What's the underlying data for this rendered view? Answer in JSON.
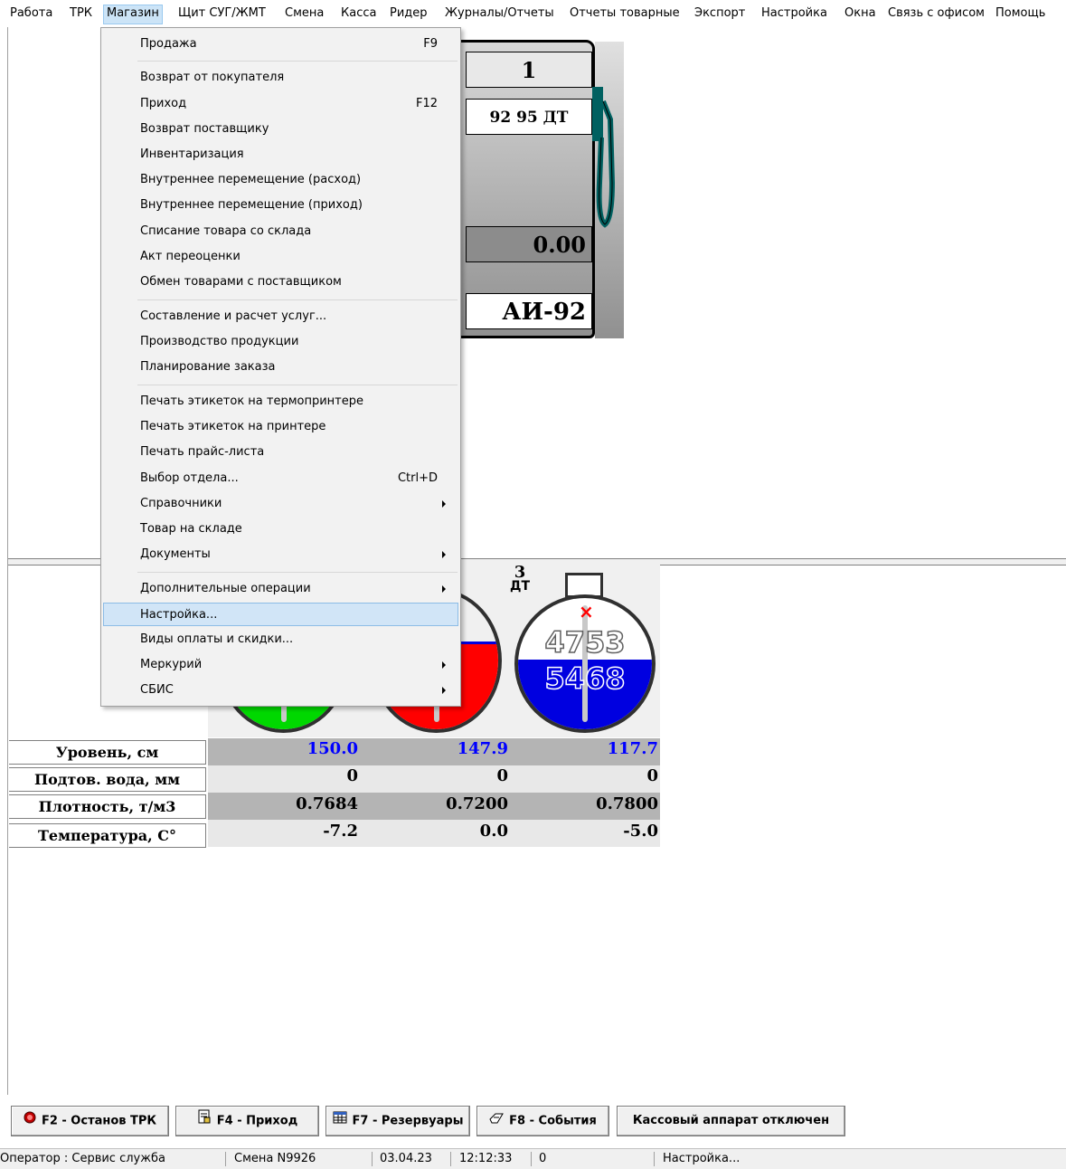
{
  "menubar": [
    "Работа",
    "ТРК",
    "Магазин",
    "Щит СУГ/ЖМТ",
    "Смена",
    "Касса",
    "Ридер",
    "Журналы/Отчеты",
    "Отчеты товарные",
    "Экспорт",
    "Настройка",
    "Окна",
    "Связь с офисом",
    "Помощь"
  ],
  "pump": {
    "number": "1",
    "fuels_line": "92 95 ДТ",
    "value": "0.00",
    "fuel": "АИ-92"
  },
  "tanks": [
    {
      "number": "3",
      "fuel": "ДТ",
      "volume_top": "4753",
      "volume_bottom": "5468"
    }
  ],
  "table": {
    "labels": [
      "Уровень, см",
      "Подтов. вода, мм",
      "Плотность, т/м3",
      "Температура, C°"
    ],
    "level": [
      "150.0",
      "147.9",
      "117.7"
    ],
    "water": [
      "0",
      "0",
      "0"
    ],
    "density": [
      "0.7684",
      "0.7200",
      "0.7800"
    ],
    "temperature": [
      "-7.2",
      "0.0",
      "-5.0"
    ]
  },
  "menu": {
    "items": [
      {
        "label": "Продажа",
        "shortcut": "F9"
      },
      {
        "label": "Возврат от покупателя"
      },
      {
        "label": "Приход",
        "shortcut": "F12"
      },
      {
        "label": "Возврат поставщику"
      },
      {
        "label": "Инвентаризация"
      },
      {
        "label": "Внутреннее перемещение (расход)"
      },
      {
        "label": "Внутреннее перемещение (приход)"
      },
      {
        "label": "Списание товара со склада"
      },
      {
        "label": "Акт переоценки"
      },
      {
        "label": "Обмен товарами с поставщиком"
      },
      {
        "label": "Составление и расчет услуг..."
      },
      {
        "label": "Производство продукции"
      },
      {
        "label": "Планирование заказа"
      },
      {
        "label": "Печать этикеток на термопринтере"
      },
      {
        "label": "Печать этикеток на принтере"
      },
      {
        "label": "Печать прайс-листа"
      },
      {
        "label": "Выбор отдела...",
        "shortcut": "Ctrl+D"
      },
      {
        "label": "Справочники"
      },
      {
        "label": "Товар на складе"
      },
      {
        "label": "Документы"
      },
      {
        "label": "Дополнительные операции"
      },
      {
        "label": "Настройка..."
      },
      {
        "label": "Виды оплаты и скидки..."
      },
      {
        "label": "Меркурий"
      },
      {
        "label": "СБИС"
      }
    ]
  },
  "buttons": [
    "F2 - Останов ТРК",
    "F4 - Приход",
    "F7 - Резервуары",
    "F8 - События",
    "Кассовый аппарат отключен"
  ],
  "status": {
    "operator": "Оператор : Сервис служба",
    "shift": "Смена N9926",
    "date": "03.04.23",
    "time": "12:12:33",
    "count": "0",
    "hint": "Настройка..."
  },
  "colors": {
    "tank1": "#00d800",
    "tank2": "#ff0000",
    "tank3": "#0000e0",
    "blue_value": "#0000ff",
    "menu_highlight": "#d1e5f7"
  }
}
